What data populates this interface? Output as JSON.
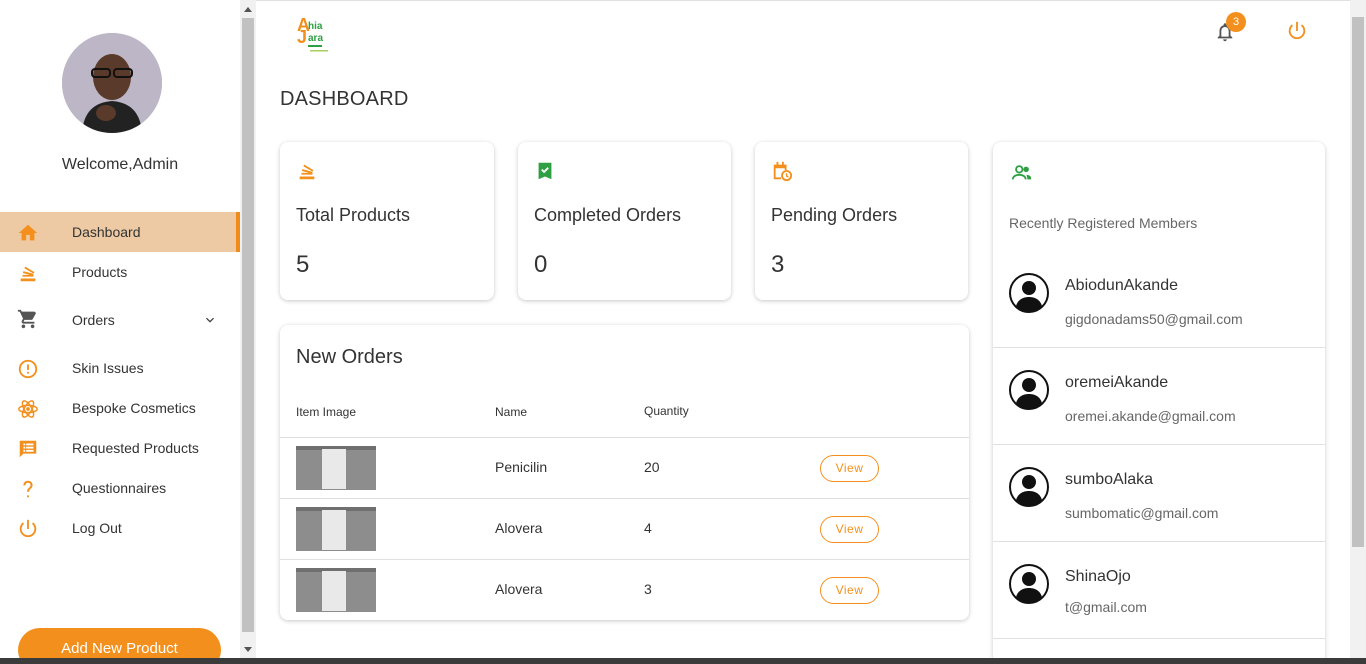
{
  "sidebar": {
    "welcome": "Welcome,Admin",
    "items": [
      {
        "label": "Dashboard",
        "icon": "home-icon",
        "active": true
      },
      {
        "label": "Products",
        "icon": "stack-icon"
      },
      {
        "label": "Orders",
        "icon": "cart-icon",
        "expandable": true
      },
      {
        "label": "Skin Issues",
        "icon": "alert-circle-icon"
      },
      {
        "label": "Bespoke Cosmetics",
        "icon": "atom-icon"
      },
      {
        "label": "Requested Products",
        "icon": "list-box-icon"
      },
      {
        "label": "Questionnaires",
        "icon": "question-icon"
      },
      {
        "label": "Log Out",
        "icon": "power-icon"
      }
    ],
    "add_button": "Add New Product"
  },
  "header": {
    "notification_count": "3",
    "logo_text": [
      "hia",
      "ara"
    ]
  },
  "page_title": "DASHBOARD",
  "stats": [
    {
      "title": "Total Products",
      "value": "5",
      "icon": "stack-icon"
    },
    {
      "title": "Completed Orders",
      "value": "0",
      "icon": "bookmark-check-icon"
    },
    {
      "title": "Pending Orders",
      "value": "3",
      "icon": "calendar-clock-icon"
    }
  ],
  "new_orders": {
    "title": "New Orders",
    "headers": [
      "Item Image",
      "Name",
      "Quantity"
    ],
    "rows": [
      {
        "name": "Penicilin",
        "quantity": "20",
        "action": "View"
      },
      {
        "name": "Alovera",
        "quantity": "4",
        "action": "View"
      },
      {
        "name": "Alovera",
        "quantity": "3",
        "action": "View"
      }
    ]
  },
  "members": {
    "title": "Recently Registered Members",
    "list": [
      {
        "name": "AbiodunAkande",
        "email": "gigdonadams50@gmail.com"
      },
      {
        "name": "oremeiAkande",
        "email": "oremei.akande@gmail.com"
      },
      {
        "name": "sumboAlaka",
        "email": "sumbomatic@gmail.com"
      },
      {
        "name": "ShinaOjo",
        "email": "t@gmail.com"
      }
    ]
  },
  "colors": {
    "accent": "#f3901d",
    "active_bg": "#edcaa3",
    "green": "#2ea043"
  }
}
